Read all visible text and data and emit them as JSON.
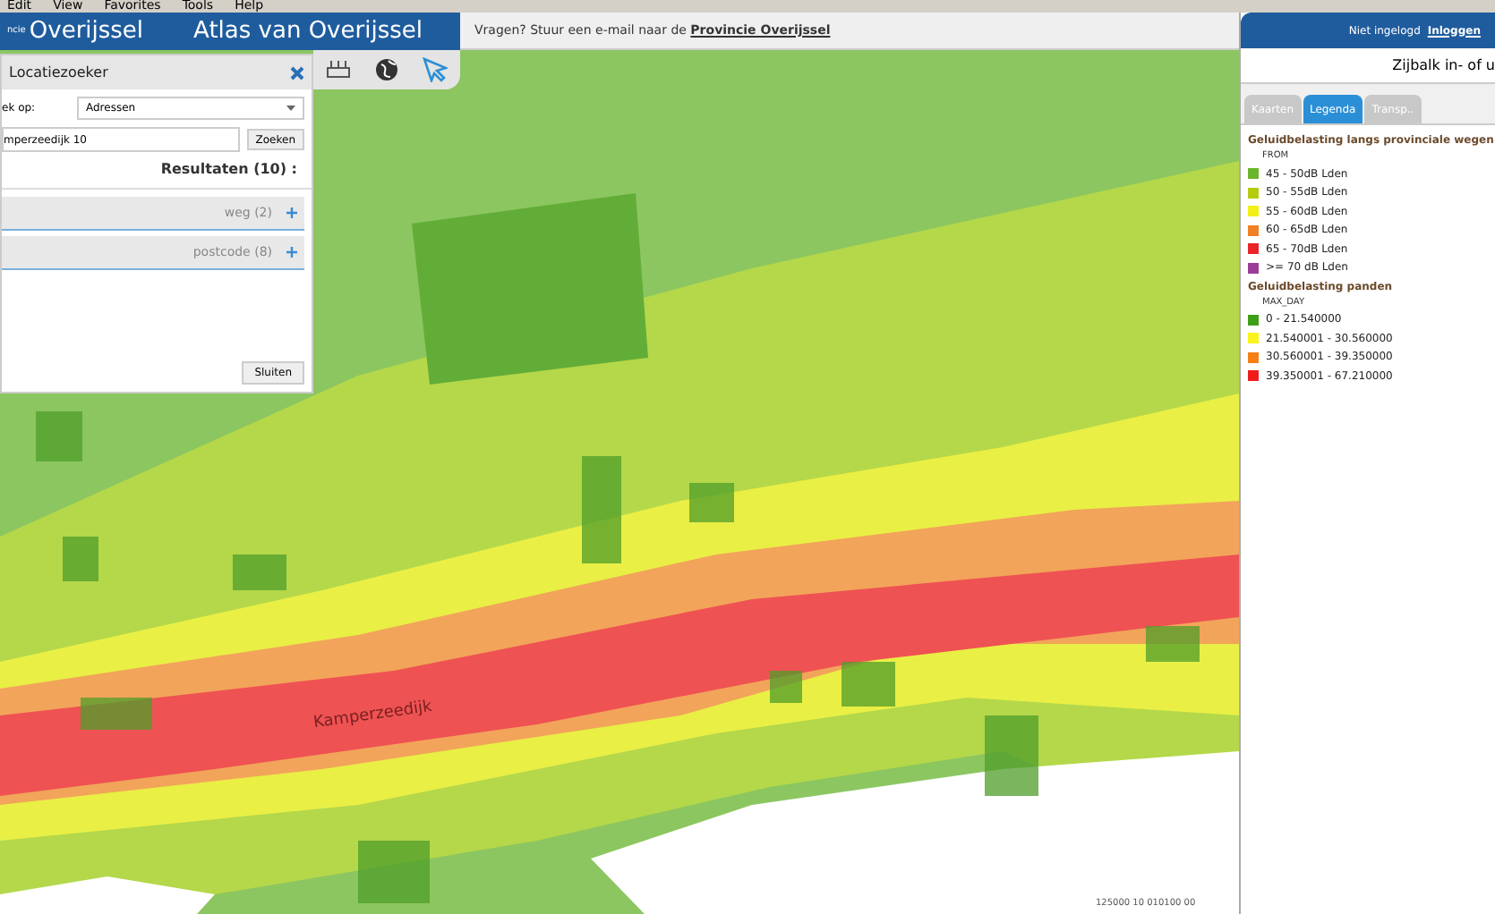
{
  "menu_bar": [
    "Edit",
    "View",
    "Favorites",
    "Tools",
    "Help"
  ],
  "header": {
    "logo_prefix": "ncie",
    "logo": "Overijssel",
    "title": "Atlas van Overijssel",
    "question": "Vragen? Stuur een e-mail naar de ",
    "question_link": "Provincie Overijssel"
  },
  "map": {
    "road_label": "Kamperzeedijk",
    "scale_text": "125000 10 010100 00"
  },
  "location_finder": {
    "title": "Locatiezoeker",
    "search_by_label": "ek op:",
    "search_by_value": "Adressen",
    "query": "mperzeedijk 10",
    "search_button": "Zoeken",
    "results_title": "Resultaten (10) :",
    "groups": [
      {
        "label": "weg (2)",
        "expanded": false
      },
      {
        "label": "postcode (8)",
        "expanded": false
      }
    ],
    "close_button": "Sluiten"
  },
  "sidebar": {
    "login_status": "Niet ingelogd",
    "login_link": "Inloggen",
    "toggle_text": "Zijbalk in- of u",
    "tabs": [
      {
        "label": "Kaarten",
        "selected": false
      },
      {
        "label": "Legenda",
        "selected": true
      },
      {
        "label": "Transp..",
        "selected": false
      }
    ],
    "legend": [
      {
        "title": "Geluidbelasting langs provinciale wegen",
        "field": "FROM",
        "items": [
          {
            "label": "45 - 50dB Lden",
            "color": "#6bb52c"
          },
          {
            "label": "50 - 55dB Lden",
            "color": "#b5cc10"
          },
          {
            "label": "55 - 60dB Lden",
            "color": "#f2ef19"
          },
          {
            "label": "60 - 65dB Lden",
            "color": "#f08024"
          },
          {
            "label": "65 - 70dB Lden",
            "color": "#e8252b"
          },
          {
            "label": ">= 70 dB Lden",
            "color": "#9b3d96"
          }
        ]
      },
      {
        "title": "Geluidbelasting panden",
        "field": "MAX_DAY",
        "items": [
          {
            "label": "0 - 21.540000",
            "color": "#3f9e18"
          },
          {
            "label": "21.540001 - 30.560000",
            "color": "#fbf41c"
          },
          {
            "label": "30.560001 - 39.350000",
            "color": "#f47f14"
          },
          {
            "label": "39.350001 - 67.210000",
            "color": "#ee1c1c"
          }
        ]
      }
    ]
  }
}
